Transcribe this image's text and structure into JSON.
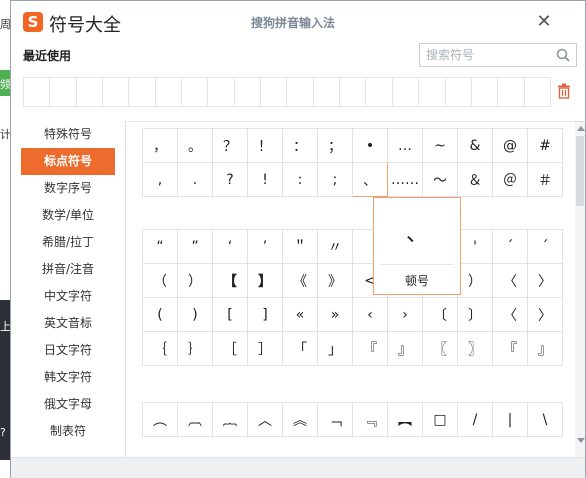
{
  "background": {
    "left_chars": [
      "周",
      "频",
      "计",
      "上",
      "?"
    ]
  },
  "window": {
    "app_title": "符号大全",
    "ime_title": "搜狗拼音输入法",
    "logo_letter": "S",
    "close_glyph": "✕"
  },
  "recent": {
    "label": "最近使用"
  },
  "search": {
    "placeholder": "搜索符号",
    "value": ""
  },
  "sidebar": {
    "items": [
      {
        "label": "特殊符号"
      },
      {
        "label": "标点符号",
        "active": true
      },
      {
        "label": "数字序号"
      },
      {
        "label": "数学/单位"
      },
      {
        "label": "希腊/拉丁"
      },
      {
        "label": "拼音/注音"
      },
      {
        "label": "中文字符"
      },
      {
        "label": "英文音标"
      },
      {
        "label": "日文字符"
      },
      {
        "label": "韩文字符"
      },
      {
        "label": "俄文字母"
      },
      {
        "label": "制表符"
      }
    ]
  },
  "grid1": [
    [
      "，",
      "。",
      "？",
      "！",
      "：",
      "；",
      "•",
      "…",
      "~",
      "&",
      "@",
      "#"
    ],
    [
      ",",
      ".",
      "?",
      "!",
      ":",
      ";",
      "、",
      "……",
      "～",
      "＆",
      "＠",
      "＃"
    ]
  ],
  "grid2": [
    [
      "“",
      "”",
      "‘",
      "’",
      "＂",
      "〃",
      "",
      "",
      "",
      "'",
      "´",
      "ˊ"
    ],
    [
      "（",
      "）",
      "【",
      "】",
      "《",
      "》",
      "<",
      "",
      "",
      "）",
      "〈",
      "〉"
    ],
    [
      "(",
      ")",
      "[",
      "]",
      "«",
      "»",
      "‹",
      "›",
      "〔",
      "〕",
      "〈",
      "〉"
    ],
    [
      "｛",
      "｝",
      "［",
      "］",
      "「",
      "」",
      "『",
      "』",
      "〖",
      "〗",
      "『",
      "』"
    ]
  ],
  "grid3": [
    [
      "︵",
      "︹",
      "︷",
      "︿",
      "︽",
      "﹁",
      "﹃",
      "︻",
      "□",
      "/",
      "|",
      "\\"
    ]
  ],
  "popup": {
    "symbol": "、",
    "name": "顿号"
  },
  "colors": {
    "accent": "#ed6c2d",
    "logo": "#f26522",
    "highlight_border": "#f0a070"
  },
  "icons": [
    "sogou-logo-icon",
    "close-icon",
    "search-icon",
    "trash-icon",
    "scroll-up-icon",
    "scroll-down-icon"
  ]
}
